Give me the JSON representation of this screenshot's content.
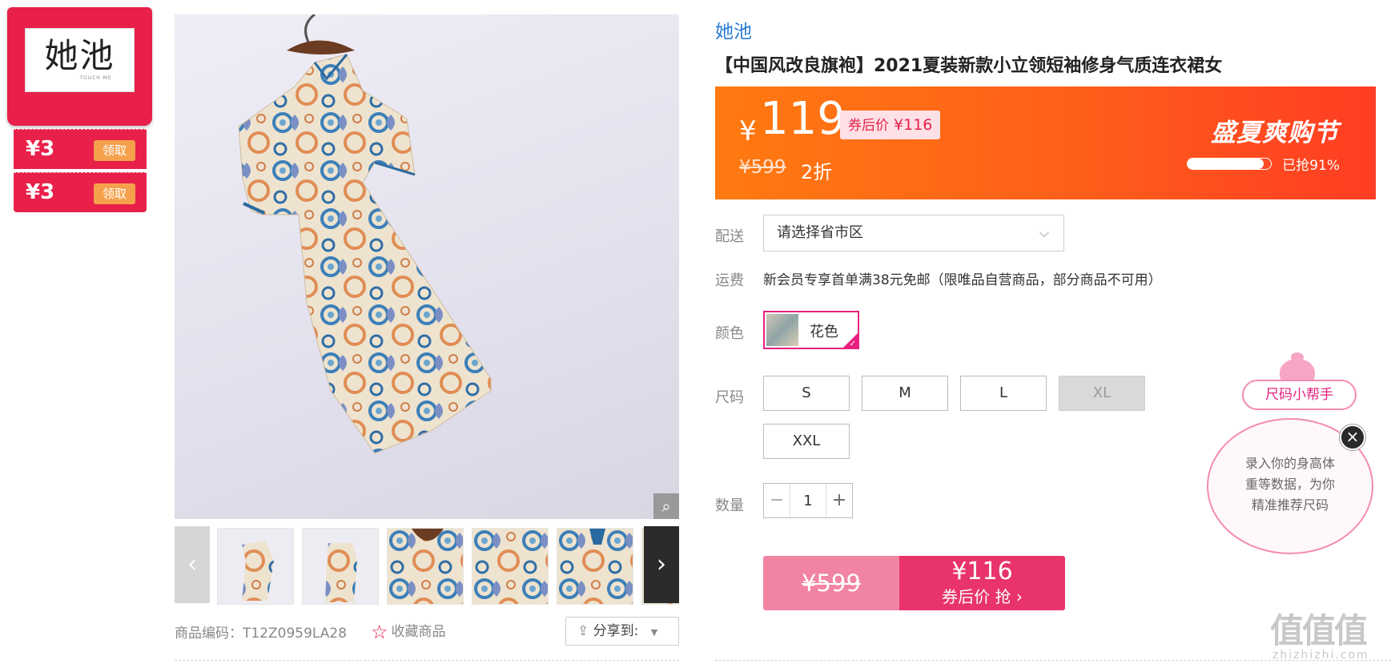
{
  "brand_card": {
    "logo_text": "她池",
    "logo_sub": "TOUCH ME",
    "coupons": [
      {
        "value": "¥3",
        "button": "领取"
      },
      {
        "value": "¥3",
        "button": "领取"
      }
    ]
  },
  "gallery": {
    "zoom_icon": "magnifier-icon",
    "prev_icon": "chevron-left-icon",
    "next_icon": "chevron-right-icon",
    "prev_glyph": "‹",
    "next_glyph": "›",
    "thumb_count": 6
  },
  "meta": {
    "sku": "商品编码：T12Z0959LA28",
    "favorite_label": "收藏商品",
    "share_label": "分享到:"
  },
  "product": {
    "brand": "她池",
    "title": "【中国风改良旗袍】2021夏装新款小立领短袖修身气质连衣裙女"
  },
  "price_banner": {
    "currency": "¥",
    "price": "119",
    "coupon_price_label": "券后价",
    "coupon_price": "¥116",
    "original_price": "¥599",
    "discount": "2折",
    "promo_title": "盛夏爽购节",
    "progress_text": "已抢91%",
    "progress_value": 0.91,
    "colors": {
      "start": "#ff7a10",
      "end": "#ff3d23"
    }
  },
  "delivery": {
    "label": "配送",
    "placeholder": "请选择省市区"
  },
  "shipping": {
    "label": "运费",
    "text": "新会员专享首单满38元免邮（限唯品自营商品，部分商品不可用）"
  },
  "color": {
    "label": "颜色",
    "options": [
      {
        "name": "花色",
        "selected": true
      }
    ]
  },
  "size": {
    "label": "尺码",
    "options": [
      {
        "name": "S",
        "available": true
      },
      {
        "name": "M",
        "available": true
      },
      {
        "name": "L",
        "available": true
      },
      {
        "name": "XL",
        "available": false
      },
      {
        "name": "XXL",
        "available": true
      }
    ]
  },
  "quantity": {
    "label": "数量",
    "value": "1",
    "minus": "−",
    "plus": "+"
  },
  "buy": {
    "original_price": "¥599",
    "coupon_price": "¥116",
    "action": "券后价 抢 ›"
  },
  "size_helper": {
    "title": "尺码小帮手",
    "line1": "录入你的身高体",
    "line2": "重等数据，为你",
    "line3": "精准推荐尺码",
    "close": "×"
  },
  "watermark": {
    "main": "值值值",
    "sub": "zhizhizhi.com"
  },
  "theme": {
    "accent": "#e8204a",
    "pink": "#e8207f",
    "link": "#2b7bd6"
  }
}
